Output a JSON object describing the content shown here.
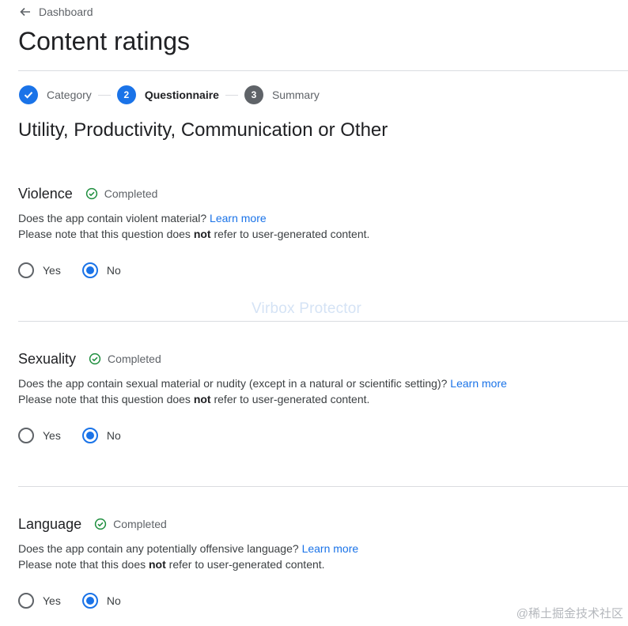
{
  "nav": {
    "back_label": "Dashboard"
  },
  "page": {
    "title": "Content ratings",
    "category_title": "Utility, Productivity, Communication or Other"
  },
  "stepper": {
    "steps": [
      {
        "label": "Category",
        "state": "done"
      },
      {
        "label": "Questionnaire",
        "number": "2",
        "state": "active"
      },
      {
        "label": "Summary",
        "number": "3",
        "state": "upcoming"
      }
    ]
  },
  "sections": [
    {
      "title": "Violence",
      "status": "Completed",
      "question": "Does the app contain violent material?",
      "link": "Learn more",
      "note_pre": "Please note that this question does ",
      "note_bold": "not",
      "note_post": " refer to user-generated content.",
      "options": [
        "Yes",
        "No"
      ],
      "selected": "No"
    },
    {
      "title": "Sexuality",
      "status": "Completed",
      "question": "Does the app contain sexual material or nudity (except in a natural or scientific setting)?",
      "link": "Learn more",
      "note_pre": "Please note that this question does ",
      "note_bold": "not",
      "note_post": " refer to user-generated content.",
      "options": [
        "Yes",
        "No"
      ],
      "selected": "No"
    },
    {
      "title": "Language",
      "status": "Completed",
      "question": "Does the app contain any potentially offensive language?",
      "link": "Learn more",
      "note_pre": "Please note that this does ",
      "note_bold": "not",
      "note_post": " refer to user-generated content.",
      "options": [
        "Yes",
        "No"
      ],
      "selected": "No"
    }
  ],
  "overlays": {
    "watermark": "Virbox Protector",
    "corner_mark": "@稀土掘金技术社区"
  },
  "colors": {
    "accent": "#1a73e8",
    "success": "#1e8e3e",
    "divider": "#dadce0"
  }
}
